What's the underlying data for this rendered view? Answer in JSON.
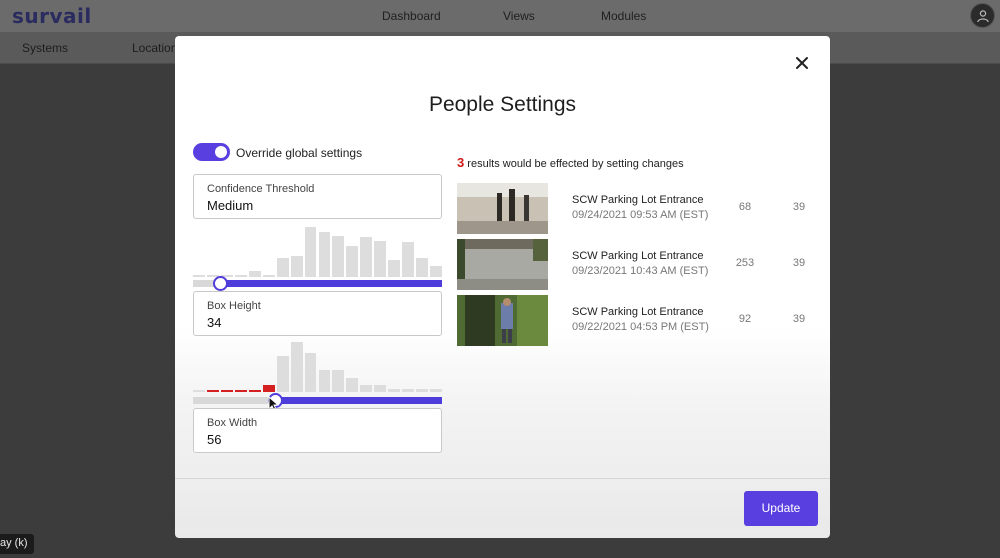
{
  "app": {
    "logo": "survail",
    "nav": [
      "Dashboard",
      "Views",
      "Modules"
    ],
    "subnav": [
      "Systems",
      "Location"
    ],
    "tooltip": "ay (k)"
  },
  "modal": {
    "title": "People Settings",
    "toggle_label": "Override global settings",
    "toggle_on": true,
    "fields": [
      {
        "label": "Confidence Threshold",
        "value": "Medium"
      },
      {
        "label": "Box Height",
        "value": "34"
      },
      {
        "label": "Box Width",
        "value": "56"
      }
    ],
    "sliders": [
      {
        "name": "box-height",
        "value_fraction": 0.11
      },
      {
        "name": "box-width",
        "value_fraction": 0.33
      }
    ],
    "histograms": [
      {
        "values": [
          0.02,
          0.02,
          0.02,
          0.05,
          0.12,
          0.05,
          0.38,
          0.42,
          1.0,
          0.9,
          0.82,
          0.62,
          0.8,
          0.72,
          0.35,
          0.7,
          0.38,
          0.22
        ],
        "highlight": []
      },
      {
        "values": [
          0.02,
          0.05,
          0.05,
          0.05,
          0.05,
          0.15,
          0.72,
          1.0,
          0.78,
          0.44,
          0.44,
          0.28,
          0.15,
          0.14,
          0.07,
          0.07,
          0.07,
          0.07
        ],
        "highlight": [
          1,
          2,
          3,
          4,
          5
        ]
      }
    ],
    "results": {
      "count": "3",
      "suffix": "results would be effected by setting changes",
      "items": [
        {
          "title": "SCW Parking Lot Entrance",
          "date": "09/24/2021 09:53 AM (EST)",
          "n1": "68",
          "n2": "39"
        },
        {
          "title": "SCW Parking Lot Entrance",
          "date": "09/23/2021 10:43 AM (EST)",
          "n1": "253",
          "n2": "39"
        },
        {
          "title": "SCW Parking Lot Entrance",
          "date": "09/22/2021 04:53 PM (EST)",
          "n1": "92",
          "n2": "39"
        }
      ]
    },
    "update_label": "Update"
  },
  "colors": {
    "accent": "#5a3fe0",
    "highlight_bar": "#d42020",
    "result_count": "#d11a1a"
  }
}
